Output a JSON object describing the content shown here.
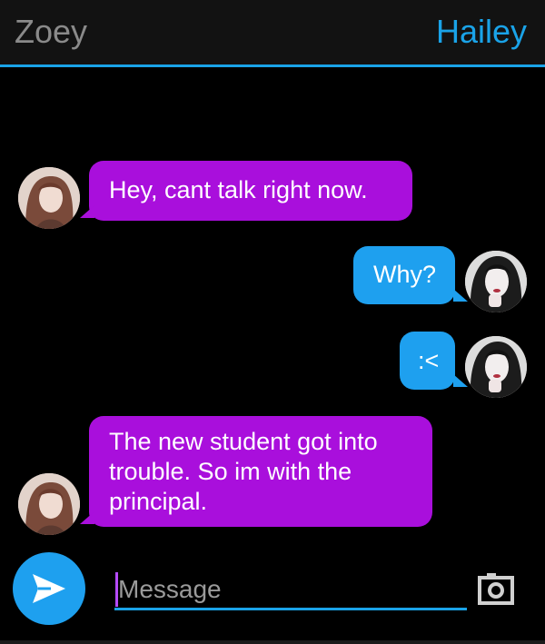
{
  "header": {
    "contact_name": "Zoey",
    "self_name": "Hailey"
  },
  "messages": [
    {
      "from": "Zoey",
      "direction": "incoming",
      "text": "Hey, cant talk right now."
    },
    {
      "from": "Hailey",
      "direction": "outgoing",
      "text": "Why?"
    },
    {
      "from": "Hailey",
      "direction": "outgoing",
      "text": ":<"
    },
    {
      "from": "Zoey",
      "direction": "incoming",
      "lines": [
        "The new student got into",
        "trouble. So im with the",
        "principal."
      ]
    }
  ],
  "composer": {
    "placeholder": "Message"
  },
  "colors": {
    "accent": "#1aa3e8",
    "incoming_bubble": "#a90fdc",
    "outgoing_bubble": "#1ea0ef",
    "background": "#000000"
  },
  "icons": {
    "send": "send-icon",
    "camera": "camera-icon"
  }
}
